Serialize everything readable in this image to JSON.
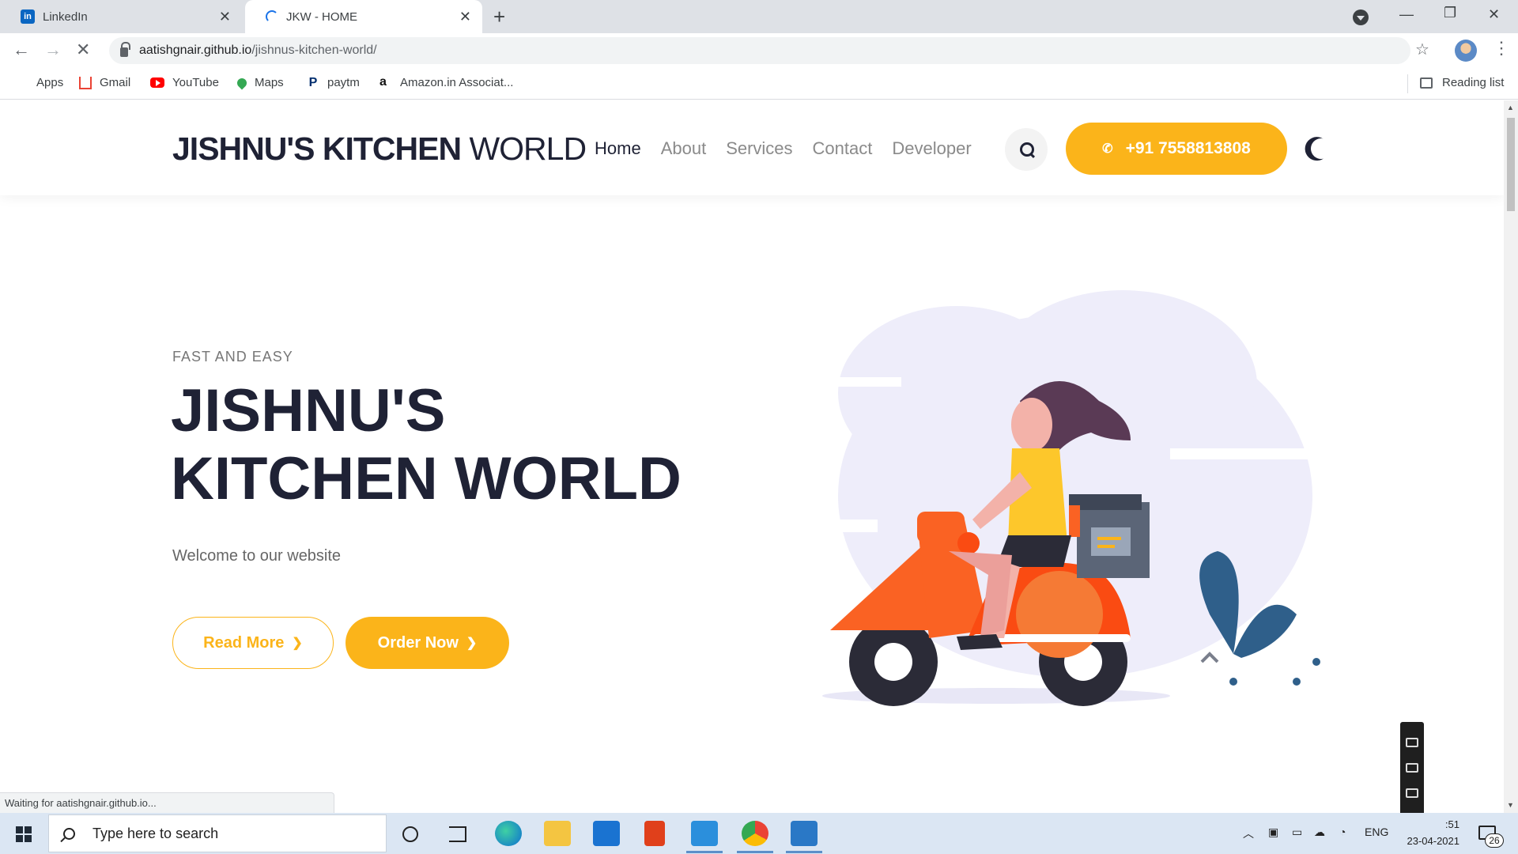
{
  "browser": {
    "tabs": [
      {
        "title": "LinkedIn",
        "favicon": "linkedin-icon"
      },
      {
        "title": "JKW - HOME",
        "favicon": "loading-spinner-icon",
        "active": true
      }
    ],
    "url_host": "aatishgnair.github.io",
    "url_path": "/jishnus-kitchen-world/",
    "bookmarks": [
      "Apps",
      "Gmail",
      "YouTube",
      "Maps",
      "paytm",
      "Amazon.in Associat..."
    ],
    "reading_list": "Reading list",
    "status_text": "Waiting for aatishgnair.github.io..."
  },
  "site": {
    "brand_bold": "JISHNU'S KITCHEN",
    "brand_light": " WORLD",
    "nav": [
      "Home",
      "About",
      "Services",
      "Contact",
      "Developer"
    ],
    "phone": "+91 7558813808",
    "eyebrow": "FAST AND EASY",
    "title_line1": "JISHNU'S",
    "title_line2": "KITCHEN WORLD",
    "subtitle": "Welcome to our website",
    "read_more": "Read More",
    "order_now": "Order Now",
    "accent_color": "#fbb41a",
    "dark_color": "#1f2235"
  },
  "taskbar": {
    "search_placeholder": "Type here to search",
    "language": "ENG",
    "time": ":51",
    "date": "23-04-2021",
    "notification_count": "26"
  }
}
